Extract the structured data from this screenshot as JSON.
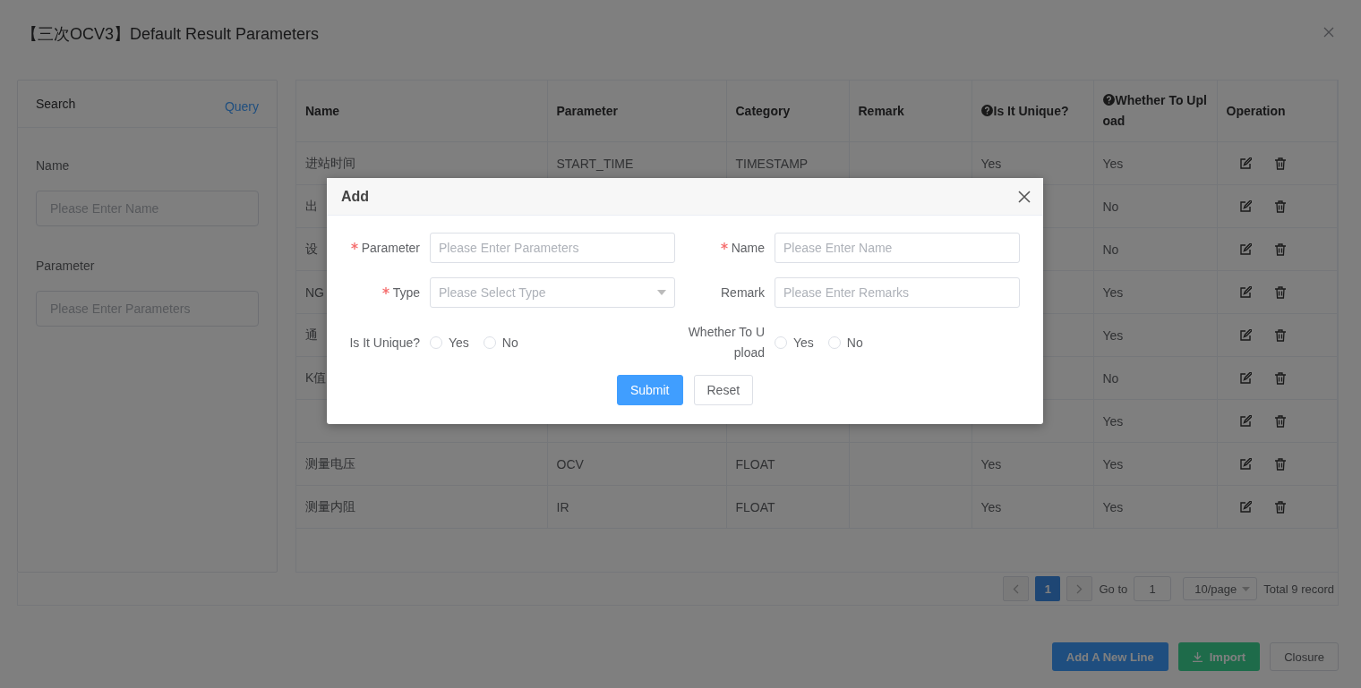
{
  "dialog": {
    "title": "【三次OCV3】Default Result Parameters",
    "search_panel": {
      "title": "Search",
      "query_link": "Query",
      "fields": [
        {
          "label": "Name",
          "placeholder": "Please Enter Name"
        },
        {
          "label": "Parameter",
          "placeholder": "Please Enter Parameters"
        }
      ]
    },
    "table": {
      "columns": [
        {
          "label": "Name",
          "kind": "plain"
        },
        {
          "label": "Parameter",
          "kind": "plain"
        },
        {
          "label": "Category",
          "kind": "plain"
        },
        {
          "label": "Remark",
          "kind": "plain"
        },
        {
          "label": "Is It Unique?",
          "kind": "help"
        },
        {
          "label": "Whether To Upload",
          "kind": "help"
        },
        {
          "label": "Operation",
          "kind": "plain"
        }
      ],
      "rows": [
        {
          "cells": [
            "进站时间",
            "START_TIME",
            "TIMESTAMP",
            null,
            "Yes",
            "Yes"
          ]
        },
        {
          "cells": [
            "出",
            null,
            null,
            null,
            null,
            "No"
          ]
        },
        {
          "cells": [
            "设",
            null,
            null,
            null,
            null,
            "No"
          ]
        },
        {
          "cells": [
            "NG",
            null,
            null,
            null,
            null,
            "Yes"
          ]
        },
        {
          "cells": [
            "通",
            null,
            null,
            null,
            null,
            "Yes"
          ]
        },
        {
          "cells": [
            "K值",
            null,
            null,
            null,
            null,
            "No"
          ]
        },
        {
          "cells": [
            null,
            null,
            null,
            null,
            null,
            "Yes"
          ]
        },
        {
          "cells": [
            "测量电压",
            "OCV",
            "FLOAT",
            null,
            "Yes",
            "Yes"
          ]
        },
        {
          "cells": [
            "测量内阻",
            "IR",
            "FLOAT",
            null,
            "Yes",
            "Yes"
          ]
        }
      ]
    },
    "pagination": {
      "pages": [
        {
          "label": "1",
          "selected": true
        }
      ],
      "goto_label": "Go to",
      "goto_value": "1",
      "page_size": "10/page",
      "total": "Total 9 record"
    },
    "buttons": [
      {
        "label": "Add A New Line",
        "kind": "primary"
      },
      {
        "label": "Import",
        "kind": "import"
      },
      {
        "label": "Closure",
        "kind": "plain"
      }
    ]
  },
  "modal": {
    "title": "Add",
    "fields": [
      {
        "label": "Parameter",
        "required": true,
        "kind": "input",
        "placeholder": "Please Enter Parameters"
      },
      {
        "label": "Name",
        "required": true,
        "kind": "input",
        "placeholder": "Please Enter Name"
      },
      {
        "label": "Type",
        "required": true,
        "kind": "select",
        "placeholder": "Please Select Type"
      },
      {
        "label": "Remark",
        "required": false,
        "kind": "input",
        "placeholder": "Please Enter Remarks"
      },
      {
        "label": "Is It Unique?",
        "required": false,
        "kind": "radio",
        "options": [
          {
            "label": "Yes",
            "selected": false
          },
          {
            "label": "No",
            "selected": false
          }
        ]
      },
      {
        "label": "Whether To Upload",
        "required": false,
        "kind": "radio",
        "options": [
          {
            "label": "Yes",
            "selected": false
          },
          {
            "label": "No",
            "selected": false
          }
        ]
      }
    ],
    "buttons": [
      {
        "label": "Submit",
        "kind": "primary"
      },
      {
        "label": "Reset",
        "kind": "plain"
      }
    ]
  }
}
